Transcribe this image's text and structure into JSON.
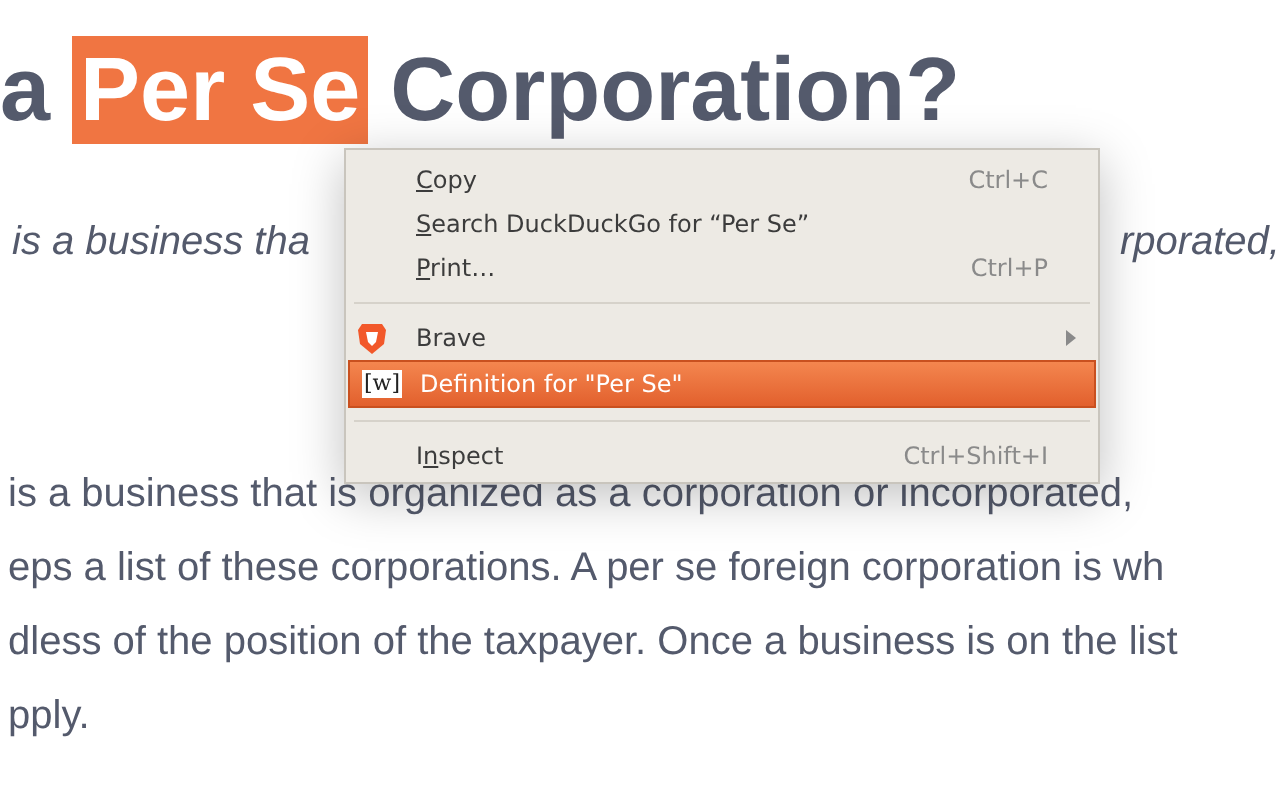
{
  "heading": {
    "before": "a",
    "selected_text": "Per Se",
    "after": "Corporation?"
  },
  "subtitle": {
    "left": "is a business tha",
    "right": "rporated,"
  },
  "body_lines": [
    "is a business that is organized as a corporation or incorporated,",
    "eps a list of these corporations. A per se foreign corporation is wh",
    "dless of the position of the taxpayer. Once a business is on the list",
    "pply."
  ],
  "context_menu": {
    "items": [
      {
        "kind": "item",
        "access_key": "C",
        "label_after": "opy",
        "shortcut": "Ctrl+C",
        "selected": false
      },
      {
        "kind": "item",
        "access_key": "S",
        "label_after": "earch DuckDuckGo for “Per Se”",
        "selected": false
      },
      {
        "kind": "item",
        "access_key": "P",
        "label_after": "rint…",
        "shortcut": "Ctrl+P",
        "selected": false
      },
      {
        "kind": "separator"
      },
      {
        "kind": "submenu",
        "label_before": "Brave",
        "selected": false
      },
      {
        "kind": "extension",
        "icon_text": "[w]",
        "label_before": "Definition for \"Per Se\"",
        "selected": true
      },
      {
        "kind": "separator"
      },
      {
        "kind": "item",
        "label_before": "I",
        "access_key": "n",
        "label_after": "spect",
        "shortcut": "Ctrl+Shift+I",
        "selected": false
      }
    ]
  }
}
